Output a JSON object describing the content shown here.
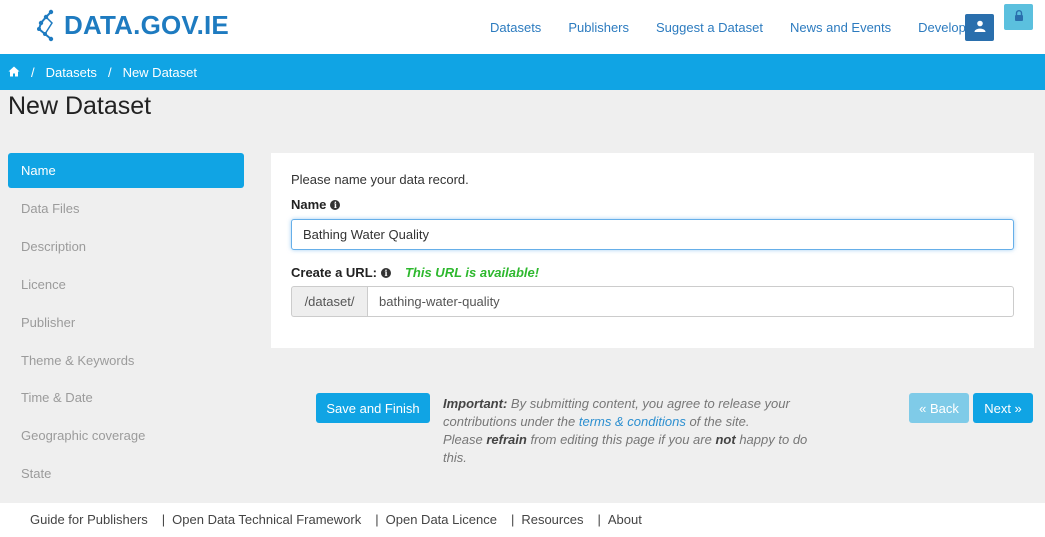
{
  "header": {
    "logo_text": "DATA.GOV.IE",
    "nav": [
      "Datasets",
      "Publishers",
      "Suggest a Dataset",
      "News and Events",
      "Developers"
    ]
  },
  "breadcrumb": {
    "items": [
      "Datasets",
      "New Dataset"
    ]
  },
  "page": {
    "title": "New Dataset"
  },
  "sidebar": {
    "items": [
      "Name",
      "Data Files",
      "Description",
      "Licence",
      "Publisher",
      "Theme & Keywords",
      "Time & Date",
      "Geographic coverage",
      "State"
    ],
    "active": "Name"
  },
  "form": {
    "intro": "Please name your data record.",
    "name_label": "Name",
    "name_value": "Bathing Water Quality",
    "url_label": "Create a URL:",
    "url_status": "This URL is available!",
    "url_prefix": "/dataset/",
    "url_value": "bathing-water-quality"
  },
  "actions": {
    "save_label": "Save and Finish",
    "back_label": "« Back",
    "next_label": "Next »"
  },
  "notice": {
    "important": "Important:",
    "text1": "By submitting content, you agree to release your contributions under the",
    "link": "terms & conditions",
    "text2": "of the site.",
    "please": "Please",
    "refrain": "refrain",
    "text3": "from editing this page if you are",
    "not": "not",
    "text4": "happy to do this."
  },
  "footer": {
    "links": [
      "Guide for Publishers",
      "Open Data Technical Framework",
      "Open Data Licence",
      "Resources",
      "About"
    ]
  },
  "colors": {
    "brand_blue": "#10a4e4",
    "logo_blue": "#1e7bc0",
    "available_green": "#2eb82e"
  }
}
